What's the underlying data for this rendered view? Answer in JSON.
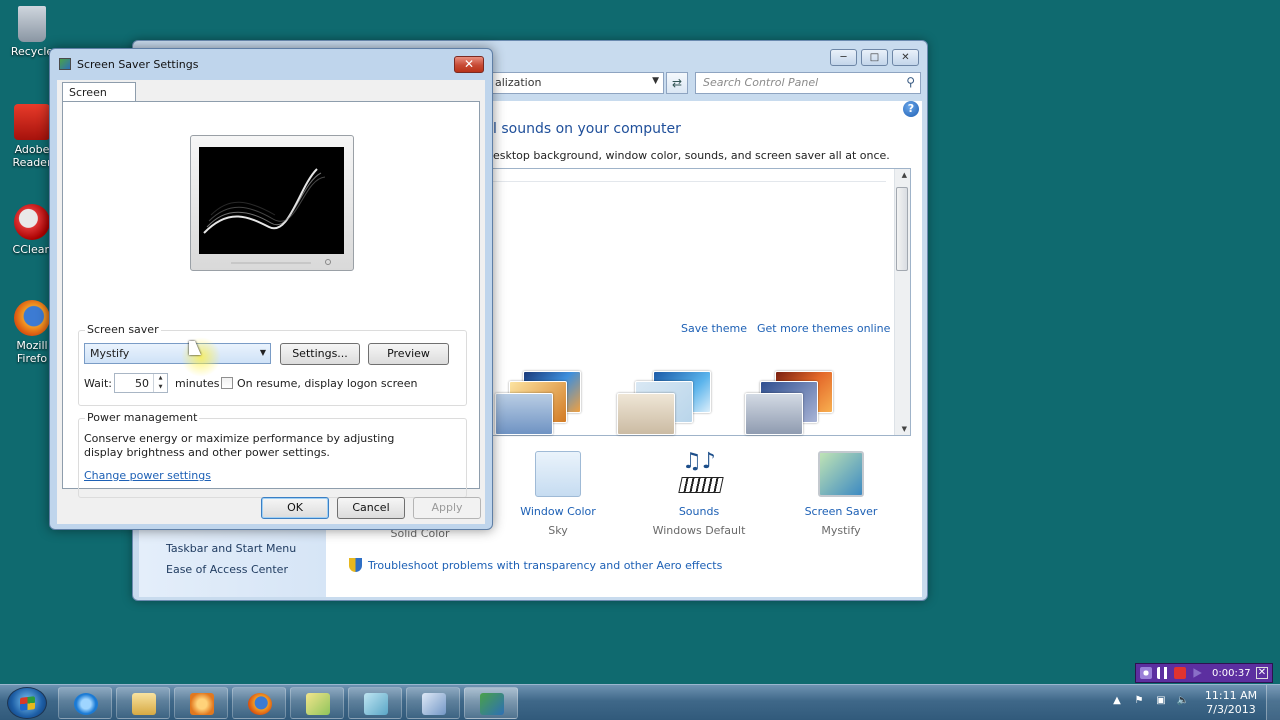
{
  "desktop": {
    "icons": [
      {
        "label": "Recycle",
        "icon": "recycle-bin-icon"
      },
      {
        "label": "Adobe\nReader",
        "icon": "adobe-reader-icon"
      },
      {
        "label": "CClean",
        "icon": "ccleaner-icon"
      },
      {
        "label": "Mozill\nFirefo",
        "icon": "firefox-icon"
      }
    ]
  },
  "control_panel": {
    "address": "alization",
    "search_placeholder": "Search Control Panel",
    "heading": "l sounds on your computer",
    "subheading": "esktop background, window color, sounds, and screen saver all at once.",
    "save_theme": "Save theme",
    "get_more_themes": "Get more themes online",
    "solid_color": "Solid Color",
    "items": [
      {
        "label": "Window Color",
        "sub": "Sky"
      },
      {
        "label": "Sounds",
        "sub": "Windows Default"
      },
      {
        "label": "Screen Saver",
        "sub": "Mystify"
      }
    ],
    "left_links": [
      "Taskbar and Start Menu",
      "Ease of Access Center"
    ],
    "troubleshoot": "Troubleshoot problems with transparency and other Aero effects"
  },
  "dialog": {
    "title": "Screen Saver Settings",
    "tab": "Screen Saver",
    "screen_saver_group": "Screen saver",
    "selected_saver": "Mystify",
    "settings_button": "Settings...",
    "preview_button": "Preview",
    "wait_label": "Wait:",
    "wait_value": "50",
    "minutes_label": "minutes",
    "resume_label": "On resume, display logon screen",
    "power_group": "Power management",
    "power_text": "Conserve energy or maximize performance by adjusting display brightness and other power settings.",
    "power_link": "Change power settings",
    "ok": "OK",
    "cancel": "Cancel",
    "apply": "Apply"
  },
  "recorder": {
    "time": "0:00:37"
  },
  "taskbar": {
    "time": "11:11 AM",
    "date": "7/3/2013"
  }
}
